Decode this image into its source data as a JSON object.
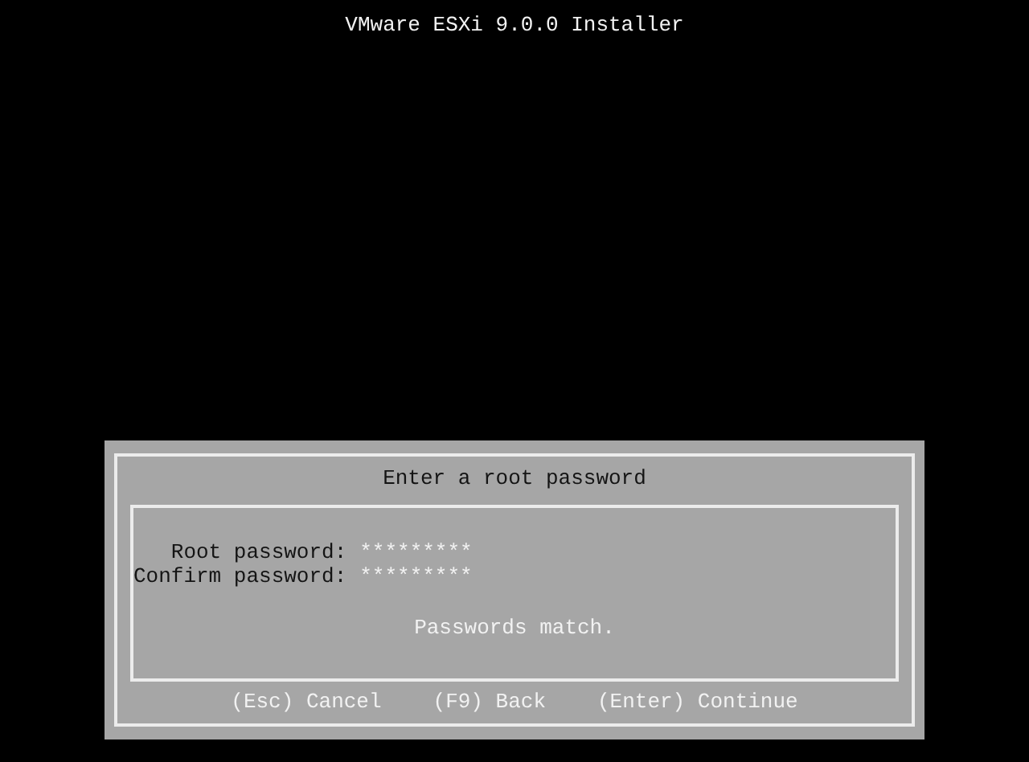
{
  "header": {
    "title": "VMware ESXi 9.0.0 Installer"
  },
  "dialog": {
    "title": "Enter a root password",
    "fields": [
      {
        "label": "Root password:",
        "value": "*********"
      },
      {
        "label": "Confirm password:",
        "value": "*********"
      }
    ],
    "message": "Passwords match.",
    "actions": [
      "(Esc) Cancel",
      "(F9) Back",
      "(Enter) Continue"
    ]
  }
}
